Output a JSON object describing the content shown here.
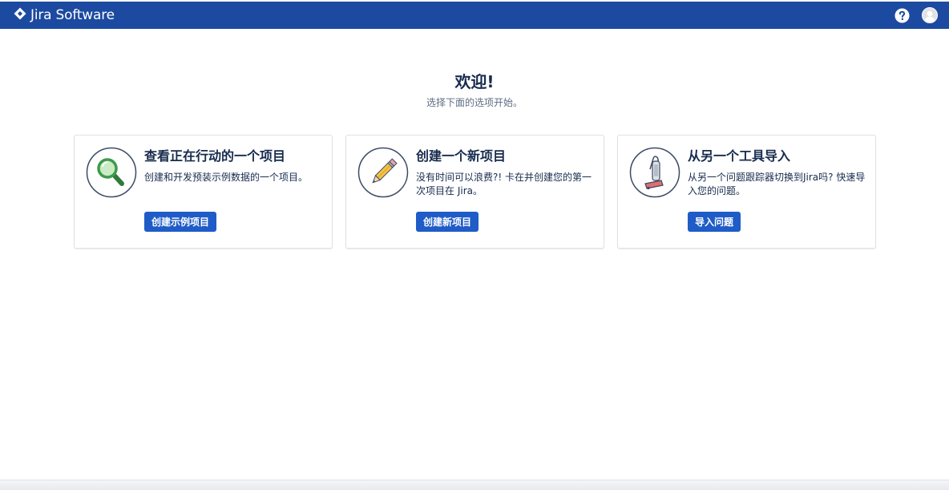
{
  "header": {
    "app_name": "Jira Software",
    "icons": [
      "jira-logo-icon",
      "help-icon",
      "avatar-icon"
    ]
  },
  "welcome": {
    "title": "欢迎!",
    "subtitle": "选择下面的选项开始。"
  },
  "cards": [
    {
      "icon": "magnifier-icon",
      "title": "查看正在行动的一个项目",
      "description": "创建和开发预装示例数据的一个项目。",
      "button": "创建示例项目"
    },
    {
      "icon": "pencil-icon",
      "title": "创建一个新项目",
      "description": "没有时间可以浪费?! 卡在并创建您的第一次项目在 Jira。",
      "button": "创建新项目"
    },
    {
      "icon": "vacuum-icon",
      "title": "从另一个工具导入",
      "description": "从另一个问题跟踪器切换到Jira吗? 快速导入您的问题。",
      "button": "导入问题"
    }
  ],
  "colors": {
    "header_bg": "#1c4aa0",
    "button_bg": "#1f5cc7",
    "text": "#172b4d"
  }
}
